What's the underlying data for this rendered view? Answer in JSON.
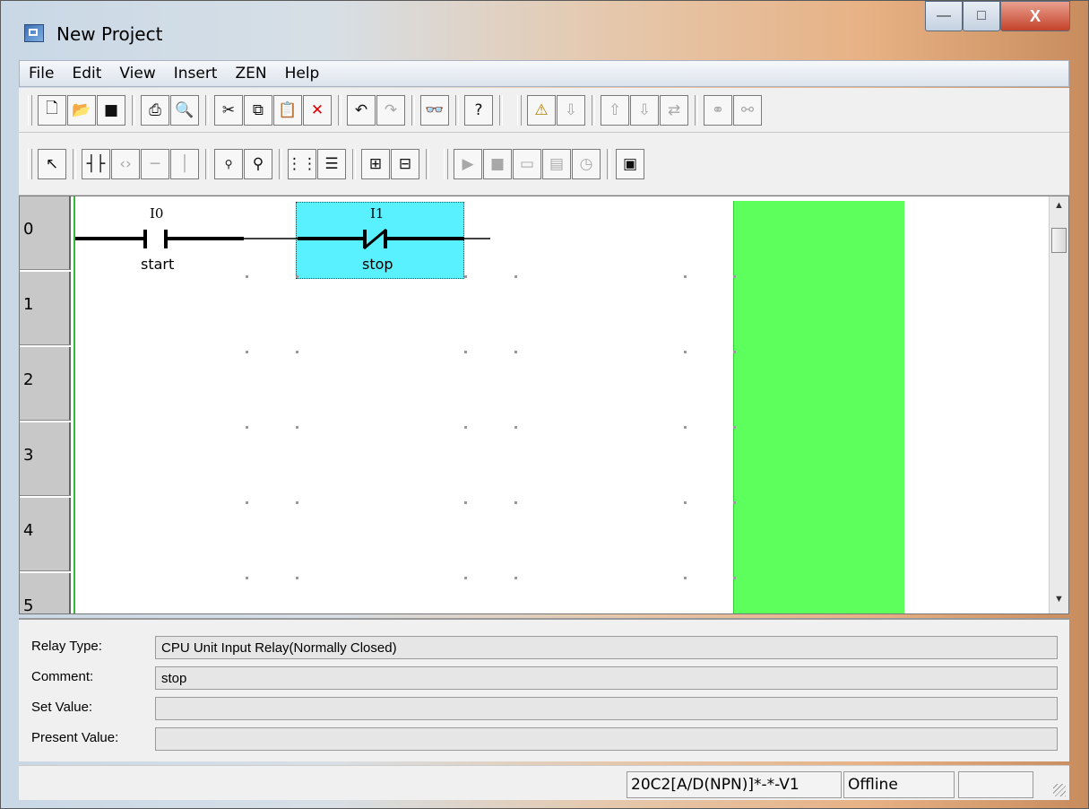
{
  "window": {
    "title": "New Project",
    "min_glyph": "—",
    "max_glyph": "□",
    "close_glyph": "X"
  },
  "menu": [
    "File",
    "Edit",
    "View",
    "Insert",
    "ZEN",
    "Help"
  ],
  "toolbar1_icons": [
    "new-icon",
    "open-icon",
    "save-icon",
    "print-icon",
    "print-preview-icon",
    "cut-icon",
    "copy-icon",
    "paste-icon",
    "delete-icon",
    "undo-icon",
    "redo-icon",
    "find-icon",
    "help-icon",
    "warning-icon",
    "transfer-icon",
    "upload-icon",
    "download-icon",
    "compare-icon",
    "connect-icon",
    "disconnect-icon"
  ],
  "toolbar2_icons": [
    "pointer-icon",
    "contact-icon",
    "coil-icon",
    "horizontal-line-icon",
    "vertical-line-icon",
    "zoom-out-icon",
    "zoom-in-icon",
    "grid-icon",
    "comment-icon",
    "program-icon",
    "parameter-icon",
    "run-icon",
    "stop-icon",
    "monitor-icon",
    "list-icon",
    "clock-icon",
    "display-icon"
  ],
  "ladder": {
    "row_numbers": [
      "0",
      "1",
      "2",
      "3",
      "4",
      "5"
    ],
    "contacts": [
      {
        "address": "I0",
        "comment": "start",
        "type": "normally-open"
      },
      {
        "address": "I1",
        "comment": "stop",
        "type": "normally-closed",
        "selected": true
      }
    ]
  },
  "info": {
    "relay_type_label": "Relay Type:",
    "relay_type_value": "CPU Unit Input Relay(Normally Closed)",
    "comment_label": "Comment:",
    "comment_value": "stop",
    "set_value_label": "Set Value:",
    "set_value_value": "",
    "present_value_label": "Present Value:",
    "present_value_value": ""
  },
  "status": {
    "model": "20C2[A/D(NPN)]*-*-V1",
    "mode": "Offline",
    "extra": ""
  }
}
